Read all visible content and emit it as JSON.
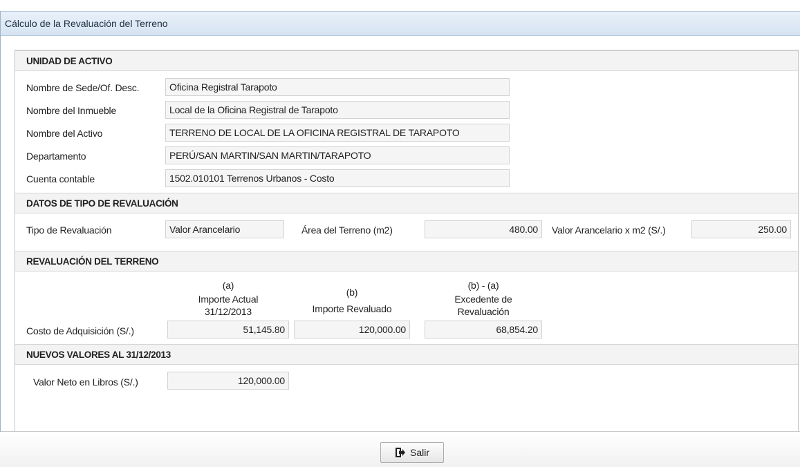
{
  "window": {
    "title": "Cálculo de la Revaluación del Terreno"
  },
  "unidad": {
    "header": "UNIDAD DE ACTIVO",
    "rows": [
      {
        "label": "Nombre de Sede/Of. Desc.",
        "value": "Oficina Registral Tarapoto"
      },
      {
        "label": "Nombre del Inmueble",
        "value": "Local de la Oficina Registral de Tarapoto"
      },
      {
        "label": "Nombre del Activo",
        "value": "TERRENO DE LOCAL DE LA OFICINA REGISTRAL DE TARAPOTO"
      },
      {
        "label": "Departamento",
        "value": "PERÚ/SAN MARTIN/SAN MARTIN/TARAPOTO"
      },
      {
        "label": "Cuenta contable",
        "value": "1502.010101 Terrenos Urbanos - Costo"
      }
    ]
  },
  "tipo": {
    "header": "DATOS DE TIPO DE REVALUACIÓN",
    "tipo_label": "Tipo de Revaluación",
    "tipo_value": "Valor Arancelario",
    "area_label": "Área del Terreno (m2)",
    "area_value": "480.00",
    "valor_label": "Valor Arancelario x m2 (S/.)",
    "valor_value": "250.00"
  },
  "revaluacion": {
    "header": "REVALUACIÓN DEL TERRENO",
    "col_a_letter": "(a)",
    "col_a_title_1": "Importe Actual",
    "col_a_title_2": "31/12/2013",
    "col_b_letter": "(b)",
    "col_b_title": "Importe Revaluado",
    "col_c_letter": "(b) - (a)",
    "col_c_title_1": "Excedente de",
    "col_c_title_2": "Revaluación",
    "row_label": "Costo de Adquisición (S/.)",
    "importe_actual": "51,145.80",
    "importe_revaluado": "120,000.00",
    "excedente": "68,854.20"
  },
  "nuevos": {
    "header": "NUEVOS VALORES AL 31/12/2013",
    "label": "Valor Neto en Libros (S/.)",
    "value": "120,000.00"
  },
  "footer": {
    "exit_label": "Salir",
    "exit_icon": "exit-icon"
  }
}
